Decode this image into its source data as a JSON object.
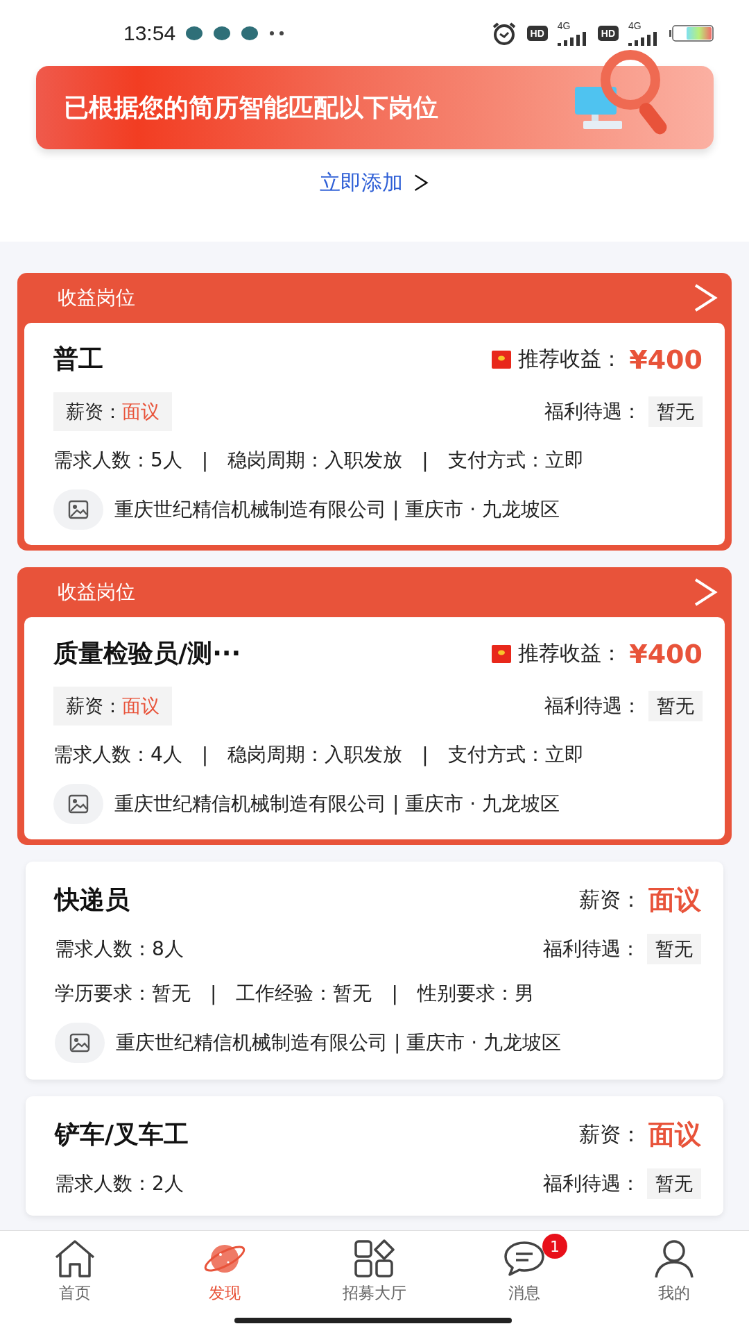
{
  "status_bar": {
    "time": "13:54",
    "hd_badges": [
      "HD",
      "HD"
    ],
    "network_labels": [
      "4G",
      "4G"
    ]
  },
  "banner": {
    "title": "已根据您的简历智能匹配以下岗位"
  },
  "add_link": {
    "label": "立即添加"
  },
  "jobs": [
    {
      "kind": "reward",
      "header": "收益岗位",
      "title": "普工",
      "reward_label": "推荐收益：",
      "reward": "¥400",
      "salary_label": "薪资：",
      "salary": "面议",
      "benefit_label": "福利待遇：",
      "benefit": "暂无",
      "details": [
        "需求人数：5人",
        "|",
        "稳岗周期：入职发放",
        "|",
        "支付方式：立即"
      ],
      "company": "重庆世纪精信机械制造有限公司 | 重庆市 · 九龙坡区"
    },
    {
      "kind": "reward",
      "header": "收益岗位",
      "title": "质量检验员/测···",
      "reward_label": "推荐收益：",
      "reward": "¥400",
      "salary_label": "薪资：",
      "salary": "面议",
      "benefit_label": "福利待遇：",
      "benefit": "暂无",
      "details": [
        "需求人数：4人",
        "|",
        "稳岗周期：入职发放",
        "|",
        "支付方式：立即"
      ],
      "company": "重庆世纪精信机械制造有限公司 | 重庆市 · 九龙坡区"
    },
    {
      "kind": "plain",
      "title": "快递员",
      "salary_label": "薪资：",
      "salary": "面议",
      "headcount": "需求人数：8人",
      "benefit_label": "福利待遇：",
      "benefit": "暂无",
      "details": [
        "学历要求：暂无",
        "|",
        "工作经验：暂无",
        "|",
        "性别要求：男"
      ],
      "company": "重庆世纪精信机械制造有限公司 | 重庆市 · 九龙坡区"
    },
    {
      "kind": "plain",
      "title": "铲车/叉车工",
      "salary_label": "薪资：",
      "salary": "面议",
      "headcount": "需求人数：2人",
      "benefit_label": "福利待遇：",
      "benefit": "暂无"
    }
  ],
  "nav": [
    {
      "label": "首页",
      "selected": false
    },
    {
      "label": "发现",
      "selected": true
    },
    {
      "label": "招募大厅",
      "selected": false
    },
    {
      "label": "消息",
      "selected": false,
      "badge": "1"
    },
    {
      "label": "我的",
      "selected": false
    }
  ]
}
